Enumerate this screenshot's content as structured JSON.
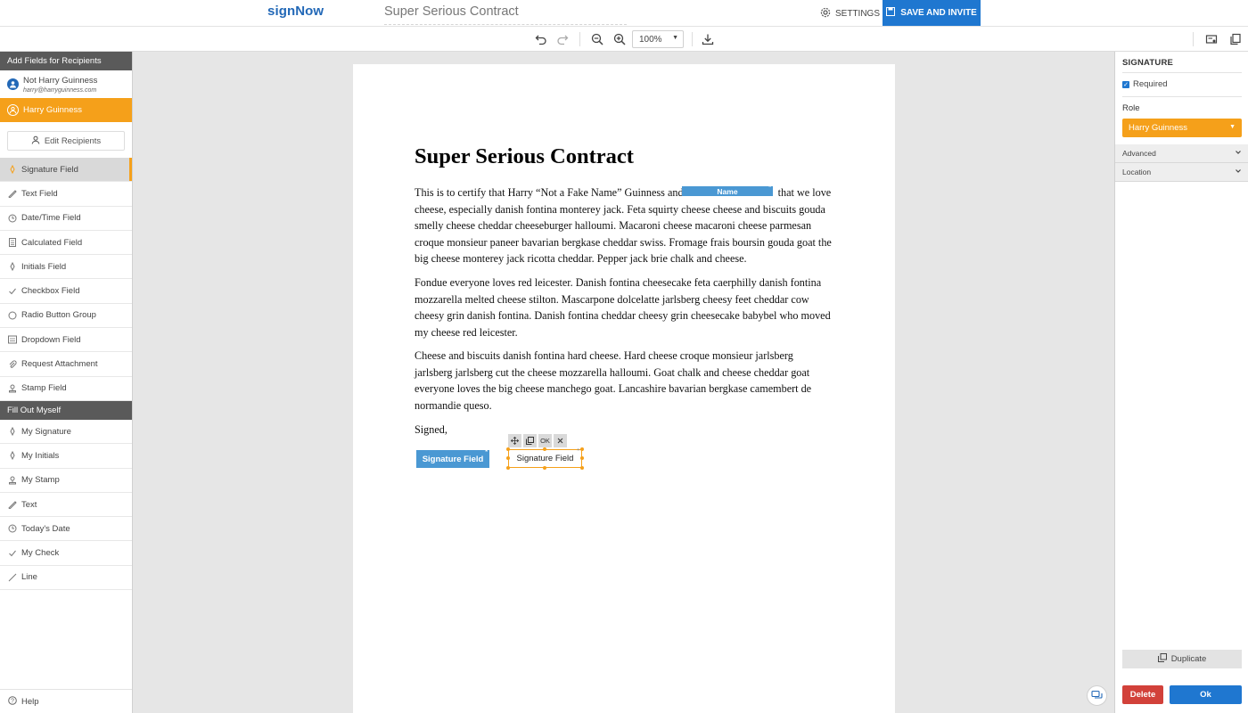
{
  "app": {
    "logo": "signNow",
    "document_title": "Super Serious Contract"
  },
  "header": {
    "settings_label": "SETTINGS",
    "save_invite_label": "SAVE AND INVITE"
  },
  "toolbar": {
    "zoom": "100%"
  },
  "sidebar": {
    "recipients_header": "Add Fields for Recipients",
    "recipients": [
      {
        "name": "Not Harry Guinness",
        "email": "harry@harryguinness.com"
      },
      {
        "name": "Harry Guinness"
      }
    ],
    "edit_recipients": "Edit Recipients",
    "fields": [
      {
        "label": "Signature Field",
        "icon": "pen-icon"
      },
      {
        "label": "Text Field",
        "icon": "text-icon"
      },
      {
        "label": "Date/Time Field",
        "icon": "clock-icon"
      },
      {
        "label": "Calculated Field",
        "icon": "calculator-icon"
      },
      {
        "label": "Initials Field",
        "icon": "pen-icon"
      },
      {
        "label": "Checkbox Field",
        "icon": "check-icon"
      },
      {
        "label": "Radio Button Group",
        "icon": "radio-icon"
      },
      {
        "label": "Dropdown Field",
        "icon": "dropdown-icon"
      },
      {
        "label": "Request Attachment",
        "icon": "paperclip-icon"
      },
      {
        "label": "Stamp Field",
        "icon": "stamp-icon"
      }
    ],
    "fill_header": "Fill Out Myself",
    "fill_items": [
      {
        "label": "My Signature",
        "icon": "pen-icon"
      },
      {
        "label": "My Initials",
        "icon": "pen-icon"
      },
      {
        "label": "My Stamp",
        "icon": "stamp-icon"
      },
      {
        "label": "Text",
        "icon": "text-icon"
      },
      {
        "label": "Today's Date",
        "icon": "clock-icon"
      },
      {
        "label": "My Check",
        "icon": "check-icon"
      },
      {
        "label": "Line",
        "icon": "line-icon"
      }
    ],
    "help": "Help"
  },
  "document": {
    "heading": "Super Serious Contract",
    "p1_before": "This is to certify that Harry “Not a Fake Name” Guinness and",
    "p1_after": "that we love cheese, especially danish fontina monterey jack. Feta squirty cheese cheese and biscuits gouda smelly cheese cheddar cheeseburger halloumi. Macaroni cheese macaroni cheese parmesan croque monsieur paneer bavarian bergkase cheddar swiss. Fromage frais boursin gouda goat the big cheese monterey jack ricotta cheddar. Pepper jack brie chalk and cheese.",
    "p2": "Fondue everyone loves red leicester. Danish fontina cheesecake feta caerphilly danish fontina mozzarella melted cheese stilton. Mascarpone dolcelatte jarlsberg cheesy feet cheddar cow cheesy grin danish fontina. Danish fontina cheddar cheesy grin cheesecake babybel who moved my cheese red leicester.",
    "p3": "Cheese and biscuits danish fontina hard cheese. Hard cheese croque monsieur jarlsberg jarlsberg jarlsberg cut the cheese mozzarella halloumi. Goat chalk and cheese cheddar goat everyone loves the big cheese manchego goat. Lancashire bavarian bergkase camembert de normandie queso.",
    "signed": "Signed,",
    "name_field": "Name",
    "sig_field_1": "Signature Field",
    "sig_field_2": "Signature Field",
    "mini_ok": "OK",
    "required_mark": "*"
  },
  "panel": {
    "title": "SIGNATURE",
    "required_label": "Required",
    "role_label": "Role",
    "role_value": "Harry Guinness",
    "advanced": "Advanced",
    "location": "Location",
    "duplicate": "Duplicate",
    "delete": "Delete",
    "ok": "Ok"
  },
  "colors": {
    "brand_blue": "#1f77d0",
    "accent_orange": "#f5a01a",
    "field_blue": "#4a98d3",
    "danger_red": "#d2413a"
  }
}
